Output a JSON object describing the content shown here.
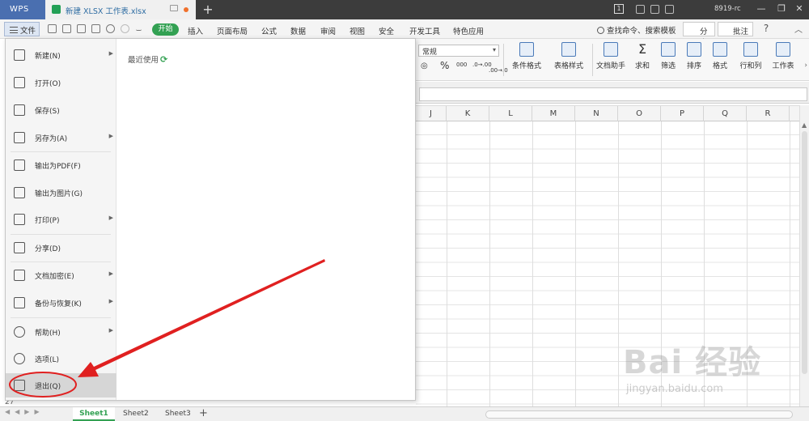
{
  "titlebar": {
    "app_logo": "WPS",
    "tab_title": "新建 XLSX 工作表.xlsx",
    "new_tab": "+",
    "window_badge": "1",
    "user": "8919-rc",
    "minimize": "—",
    "restore": "❐",
    "close": "✕"
  },
  "menubar": {
    "file": "文件",
    "start": "开始",
    "tabs": [
      "插入",
      "页面布局",
      "公式",
      "数据",
      "审阅",
      "视图",
      "安全",
      "开发工具",
      "特色应用"
    ],
    "search": "查找命令、搜索模板",
    "share": "分享",
    "annotate": "批注",
    "help": "?"
  },
  "ribbon": {
    "number_format": "常规",
    "percent": "%",
    "thousands": "000",
    "dec_inc": ".0→.00",
    "dec_dec": ".00→.0",
    "buttons": [
      "条件格式",
      "表格样式",
      "文档助手",
      "求和",
      "筛选",
      "排序",
      "格式",
      "行和列",
      "工作表"
    ]
  },
  "grid": {
    "columns": [
      "J",
      "K",
      "L",
      "M",
      "N",
      "O",
      "P",
      "Q",
      "R"
    ],
    "visible_row": "27"
  },
  "sheets": {
    "tabs": [
      "Sheet1",
      "Sheet2",
      "Sheet3"
    ],
    "add": "+"
  },
  "file_menu": {
    "items": [
      {
        "label": "新建(N)",
        "icon": "new-file-icon",
        "submenu": true
      },
      {
        "label": "打开(O)",
        "icon": "folder-icon",
        "submenu": false
      },
      {
        "label": "保存(S)",
        "icon": "save-icon",
        "submenu": false
      },
      {
        "label": "另存为(A)",
        "icon": "save-as-icon",
        "submenu": true
      },
      {
        "label": "输出为PDF(F)",
        "icon": "pdf-icon",
        "submenu": false
      },
      {
        "label": "输出为图片(G)",
        "icon": "image-icon",
        "submenu": false
      },
      {
        "label": "打印(P)",
        "icon": "printer-icon",
        "submenu": true
      },
      {
        "label": "分享(D)",
        "icon": "share-icon",
        "submenu": false
      },
      {
        "label": "文档加密(E)",
        "icon": "lock-doc-icon",
        "submenu": true
      },
      {
        "label": "备份与恢复(K)",
        "icon": "backup-icon",
        "submenu": true
      },
      {
        "label": "帮助(H)",
        "icon": "help-circle-icon",
        "submenu": true
      },
      {
        "label": "选项(L)",
        "icon": "gear-icon",
        "submenu": false
      },
      {
        "label": "退出(Q)",
        "icon": "exit-icon",
        "submenu": false
      }
    ],
    "recent": "最近使用"
  },
  "watermark": {
    "brand": "Bai 经验",
    "url": "jingyan.baidu.com"
  },
  "colors": {
    "accent_green": "#33a153",
    "annotation_red": "#e02020",
    "titlebar": "#3c3c3c"
  }
}
